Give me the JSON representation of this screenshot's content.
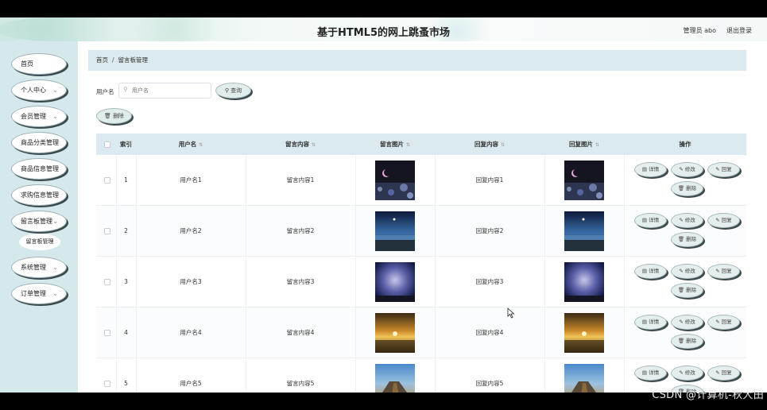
{
  "header": {
    "title": "基于HTML5的网上跳蚤市场",
    "admin": "管理员 abo",
    "logout": "退出登录"
  },
  "sidebar": {
    "items": [
      {
        "label": "首页",
        "has_chevron": false
      },
      {
        "label": "个人中心",
        "has_chevron": true
      },
      {
        "label": "会员管理",
        "has_chevron": true
      },
      {
        "label": "商品分类管理",
        "has_chevron": true
      },
      {
        "label": "商品信息管理",
        "has_chevron": true
      },
      {
        "label": "求购信息管理",
        "has_chevron": true
      },
      {
        "label": "留言板管理",
        "has_chevron": true
      },
      {
        "label": "系统管理",
        "has_chevron": true
      },
      {
        "label": "订单管理",
        "has_chevron": true
      }
    ],
    "submenu": {
      "label": "留言板管理"
    }
  },
  "breadcrumb": {
    "home": "首页",
    "sep": "/",
    "current": "留言板管理"
  },
  "search": {
    "label": "用户名",
    "placeholder": "用户名",
    "button": "查询"
  },
  "toolbar": {
    "delete": "删除"
  },
  "table": {
    "columns": [
      "索引",
      "用户名",
      "留言内容",
      "留言图片",
      "回复内容",
      "回复图片",
      "操作"
    ],
    "sort_icon": "⇅",
    "rows": [
      {
        "index": "1",
        "username": "用户名1",
        "message": "留言内容1",
        "reply": "回复内容1",
        "image": "night-moon"
      },
      {
        "index": "2",
        "username": "用户名2",
        "message": "留言内容2",
        "reply": "回复内容2",
        "image": "starry-lake"
      },
      {
        "index": "3",
        "username": "用户名3",
        "message": "留言内容3",
        "reply": "回复内容3",
        "image": "milky-way"
      },
      {
        "index": "4",
        "username": "用户名4",
        "message": "留言内容4",
        "reply": "回复内容4",
        "image": "sunset-sea"
      },
      {
        "index": "5",
        "username": "用户名5",
        "message": "留言内容5",
        "reply": "回复内容5",
        "image": "sky-road"
      }
    ],
    "actions": {
      "detail": "详情",
      "edit": "修改",
      "reply": "回复",
      "delete": "删除"
    }
  },
  "watermark": "CSDN @计算机-秋大田",
  "colors": {
    "accent_panel": "#dbeaee",
    "sidebar_bg": "#d5e8ec",
    "button_shadow": "#3b4a4d"
  }
}
